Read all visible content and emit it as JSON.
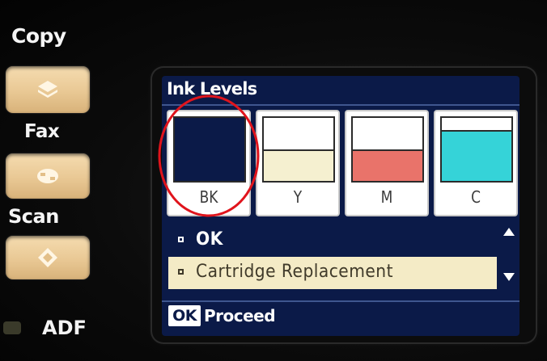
{
  "side_panel": {
    "copy_label": "Copy",
    "fax_label": "Fax",
    "scan_label": "Scan",
    "adf_label": "ADF"
  },
  "screen": {
    "title": "Ink Levels",
    "cartridges": [
      {
        "code": "BK",
        "level": 1.0,
        "color": "#0b1a48"
      },
      {
        "code": "Y",
        "level": 0.48,
        "color": "#f5f0d0"
      },
      {
        "code": "M",
        "level": 0.48,
        "color": "#e9736a"
      },
      {
        "code": "C",
        "level": 0.78,
        "color": "#35d3d8"
      }
    ],
    "menu": {
      "items": [
        {
          "label": "OK"
        },
        {
          "label": "Cartridge Replacement"
        }
      ]
    },
    "footer": {
      "key_label": "OK",
      "action_label": "Proceed"
    }
  },
  "annotation": {
    "color": "#e0141c"
  }
}
